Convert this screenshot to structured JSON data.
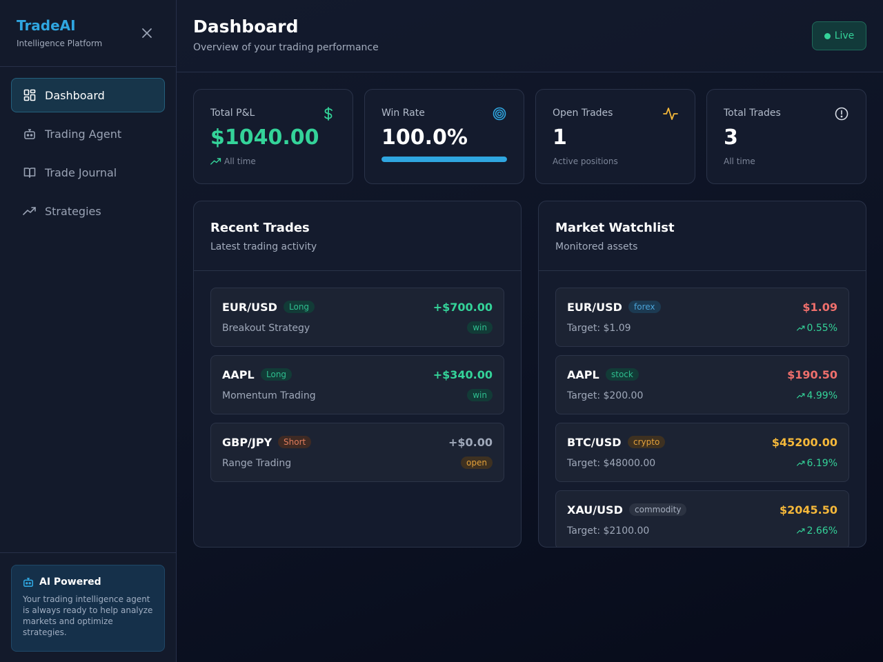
{
  "brand": {
    "title": "TradeAI",
    "subtitle": "Intelligence Platform"
  },
  "nav": [
    {
      "label": "Dashboard",
      "icon": "grid-icon",
      "active": true
    },
    {
      "label": "Trading Agent",
      "icon": "bot-icon"
    },
    {
      "label": "Trade Journal",
      "icon": "book-icon"
    },
    {
      "label": "Strategies",
      "icon": "trending-up-icon"
    }
  ],
  "ai_card": {
    "title": "AI Powered",
    "text": "Your trading intelligence agent is always ready to help analyze markets and optimize strategies."
  },
  "header": {
    "title": "Dashboard",
    "subtitle": "Overview of your trading performance",
    "live": "Live"
  },
  "stats": {
    "pnl": {
      "label": "Total P&L",
      "value": "$1040.00",
      "note": "All time"
    },
    "win_rate": {
      "label": "Win Rate",
      "value": "100.0%",
      "progress": 1.0
    },
    "open": {
      "label": "Open Trades",
      "value": "1",
      "note": "Active positions"
    },
    "total": {
      "label": "Total Trades",
      "value": "3",
      "note": "All time"
    }
  },
  "recent": {
    "title": "Recent Trades",
    "subtitle": "Latest trading activity",
    "trades": [
      {
        "symbol": "EUR/USD",
        "side": "Long",
        "strategy": "Breakout Strategy",
        "pnl": "+$700.00",
        "status": "win"
      },
      {
        "symbol": "AAPL",
        "side": "Long",
        "strategy": "Momentum Trading",
        "pnl": "+$340.00",
        "status": "win"
      },
      {
        "symbol": "GBP/JPY",
        "side": "Short",
        "strategy": "Range Trading",
        "pnl": "+$0.00",
        "status": "open"
      }
    ]
  },
  "watchlist": {
    "title": "Market Watchlist",
    "subtitle": "Monitored assets",
    "assets": [
      {
        "symbol": "EUR/USD",
        "type": "forex",
        "target": "Target: $1.09",
        "price": "$1.09",
        "change": "0.55%"
      },
      {
        "symbol": "AAPL",
        "type": "stock",
        "target": "Target: $200.00",
        "price": "$190.50",
        "change": "4.99%"
      },
      {
        "symbol": "BTC/USD",
        "type": "crypto",
        "target": "Target: $48000.00",
        "price": "$45200.00",
        "change": "6.19%"
      },
      {
        "symbol": "XAU/USD",
        "type": "commodity",
        "target": "Target: $2100.00",
        "price": "$2045.50",
        "change": "2.66%"
      }
    ]
  },
  "colors": {
    "accent": "#2fa6e0",
    "positive": "#34d399",
    "negative": "#ef6f6c",
    "warning": "#f5b83a"
  }
}
